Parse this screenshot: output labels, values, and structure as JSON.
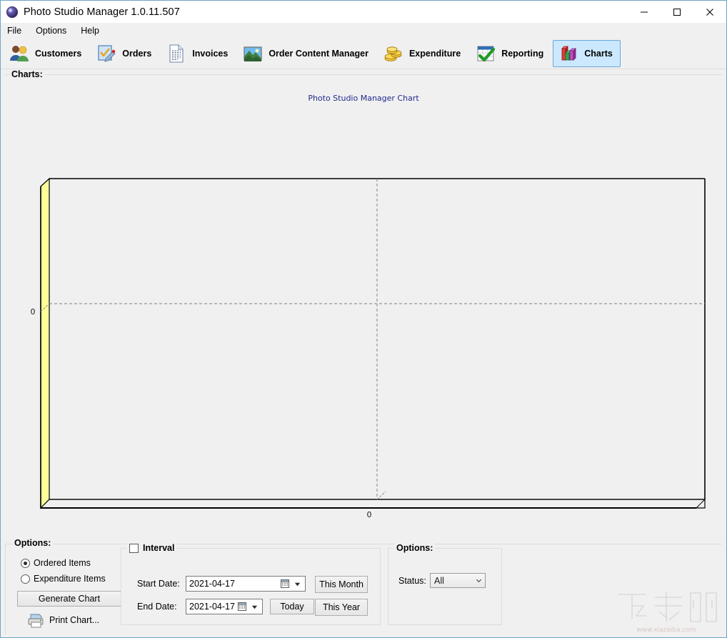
{
  "window": {
    "title": "Photo Studio Manager 1.0.11.507",
    "app_icon": "camera-lens-icon",
    "minimize_label": "–",
    "maximize_label": "□",
    "close_label": "✕"
  },
  "menubar": {
    "items": [
      {
        "label": "File"
      },
      {
        "label": "Options"
      },
      {
        "label": "Help"
      }
    ]
  },
  "toolbar": {
    "items": [
      {
        "label": "Customers",
        "icon": "two-users-icon",
        "selected": false
      },
      {
        "label": "Orders",
        "icon": "checklist-pen-icon",
        "selected": false
      },
      {
        "label": "Invoices",
        "icon": "document-lines-icon",
        "selected": false
      },
      {
        "label": "Order Content Manager",
        "icon": "photo-landscape-icon",
        "selected": false
      },
      {
        "label": "Expenditure",
        "icon": "gold-coins-icon",
        "selected": false
      },
      {
        "label": "Reporting",
        "icon": "calendar-checkmark-icon",
        "selected": false
      },
      {
        "label": "Charts",
        "icon": "bar-chart-3d-icon",
        "selected": true
      }
    ]
  },
  "charts_group": {
    "label": "Charts:"
  },
  "chart_data": {
    "type": "bar",
    "title": "Photo Studio Manager Chart",
    "xlabel": "",
    "ylabel": "",
    "categories": [],
    "values": [],
    "series": [],
    "x_ticks": [
      "0"
    ],
    "y_ticks": [
      "0"
    ],
    "xlim": [
      0,
      0
    ],
    "ylim": [
      0,
      0
    ],
    "grid": true,
    "legend": "none",
    "empty": true,
    "title_color": "#212a8c",
    "wall_color": "#ffff99",
    "axis_color": "#000000",
    "grid_color": "#808080"
  },
  "options_group": {
    "label": "Options:",
    "chart_source": {
      "options": [
        {
          "label": "Ordered Items",
          "checked": true
        },
        {
          "label": "Expenditure Items",
          "checked": false
        }
      ]
    },
    "generate_button": "Generate Chart",
    "print_button": "Print Chart...",
    "print_icon": "printer-icon"
  },
  "interval": {
    "label": "Interval",
    "checked": false,
    "start_date_label": "Start Date:",
    "start_date_value": "2021-04-17",
    "end_date_label": "End Date:",
    "end_date_value": "2021-04-17",
    "today_button": "Today",
    "this_month_button": "This Month",
    "this_year_button": "This Year",
    "calendar_icon": "calendar-icon",
    "dropdown_icon": "chevron-down-icon"
  },
  "status_options": {
    "label": "Options:",
    "status_label": "Status:",
    "status_value": "All",
    "status_options": [
      "All"
    ]
  },
  "watermark": {
    "text": "下载吧",
    "url": "www.xiazaiba.com"
  }
}
